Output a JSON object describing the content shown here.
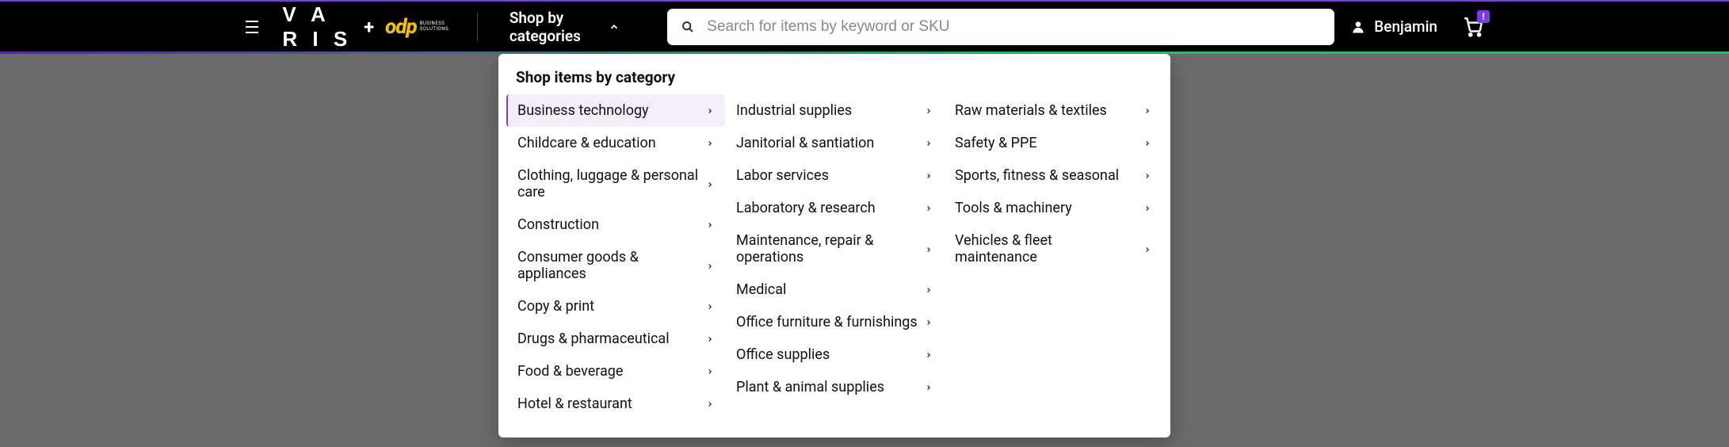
{
  "header": {
    "logo_varis": "V A R I S",
    "logo_plus": "+",
    "logo_odp": "odp",
    "logo_odp_sub1": "BUSINESS",
    "logo_odp_sub2": "SOLUTIONS",
    "shop_by_categories": "Shop by categories",
    "search_placeholder": "Search for items by keyword or SKU",
    "user_name": "Benjamin",
    "cart_badge": "!"
  },
  "mega": {
    "title": "Shop items by category",
    "col1": [
      "Business technology",
      "Childcare & education",
      "Clothing, luggage & personal care",
      "Construction",
      "Consumer goods & appliances",
      "Copy & print",
      "Drugs & pharmaceutical",
      "Food & beverage",
      "Hotel & restaurant"
    ],
    "col2": [
      "Industrial supplies",
      "Janitorial & santiation",
      "Labor services",
      "Laboratory & research",
      "Maintenance, repair & operations",
      "Medical",
      "Office furniture & furnishings",
      "Office supplies",
      "Plant & animal supplies"
    ],
    "col3": [
      "Raw materials & textiles",
      "Safety & PPE",
      "Sports, fitness & seasonal",
      "Tools & machinery",
      "Vehicles & fleet maintenance"
    ]
  }
}
